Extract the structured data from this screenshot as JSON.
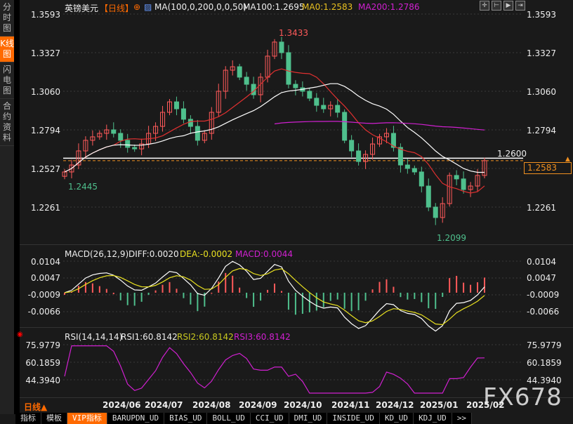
{
  "sidebar": {
    "tabs": [
      {
        "label": "分时图",
        "active": false
      },
      {
        "label": "K线图",
        "active": true
      },
      {
        "label": "闪电图",
        "active": false
      },
      {
        "label": "合约资料",
        "active": false
      }
    ]
  },
  "header": {
    "symbol": "英镑美元",
    "period": "【日线】",
    "indicator": "MA(100,0,200,0,0,50)",
    "ma100": "MA100:1.2695",
    "ma0": "MA0:1.2583",
    "ma200": "MA200:1.2786"
  },
  "toolbar": {
    "icons": [
      "crosshair-icon",
      "zoom-in-icon",
      "zoom-out-icon",
      "move-right-icon"
    ]
  },
  "price_axis": [
    "1.3593",
    "1.3327",
    "1.3060",
    "1.2794",
    "1.2527",
    "1.2261"
  ],
  "annotations": {
    "high": "1.3433",
    "low_start": "1.2445",
    "low": "1.2099",
    "line_level": "1.2600",
    "current_price": "1.2583"
  },
  "macd": {
    "title": "MACD(26,12,9)",
    "diff": "DIFF:0.0020",
    "dea": "DEA:-0.0002",
    "macd": "MACD:0.0044",
    "axis": [
      "0.0104",
      "0.0047",
      "-0.0009",
      "-0.0066"
    ]
  },
  "rsi": {
    "title": "RSI(14,14,14)",
    "rsi1": "RSI1:60.8142",
    "rsi2": "RSI2:60.8142",
    "rsi3": "RSI3:60.8142",
    "axis": [
      "75.9779",
      "60.1859",
      "44.3940"
    ]
  },
  "period_label": "日线▲",
  "dates": [
    "2024/06",
    "2024/07",
    "2024/08",
    "2024/09",
    "2024/10",
    "2024/11",
    "2024/12",
    "2025/01",
    "2025/02"
  ],
  "bottom_tabs": [
    "指标",
    "模板",
    "VIP指标",
    "BARUPDN_UD",
    "BIAS_UD",
    "BOLL_UD",
    "CCI_UD",
    "DMI_UD",
    "INSIDE_UD",
    "KD_UD",
    "KDJ_UD",
    ">>"
  ],
  "watermark": "FX678",
  "colors": {
    "up": "#ff5a5a",
    "down": "#4fc08d",
    "ma_red": "#e03030",
    "ma_white": "#ffffff",
    "ma200": "#d020d0",
    "dea": "#e8e020",
    "accent": "#ff6a00"
  },
  "chart_data": {
    "type": "candlestick",
    "closes": [
      1.2505,
      1.2553,
      1.265,
      1.2723,
      1.2747,
      1.2771,
      1.2795,
      1.2771,
      1.2723,
      1.2674,
      1.2664,
      1.2698,
      1.2771,
      1.2819,
      1.2916,
      1.2988,
      1.294,
      1.2868,
      1.2819,
      1.2723,
      1.2771,
      1.2916,
      1.3061,
      1.3206,
      1.323,
      1.3158,
      1.3109,
      1.3037,
      1.3158,
      1.3303,
      1.34,
      1.3327,
      1.3109,
      1.3085,
      1.3061,
      1.3013,
      1.2964,
      1.294,
      1.2964,
      1.2916,
      1.2723,
      1.265,
      1.2577,
      1.2626,
      1.2698,
      1.2747,
      1.2771,
      1.2674,
      1.2553,
      1.2529,
      1.2505,
      1.2408,
      1.2263,
      1.2191,
      1.2287,
      1.2481,
      1.2457,
      1.2384,
      1.2408,
      1.2481,
      1.2583
    ],
    "ylim": [
      1.213,
      1.3593
    ]
  }
}
